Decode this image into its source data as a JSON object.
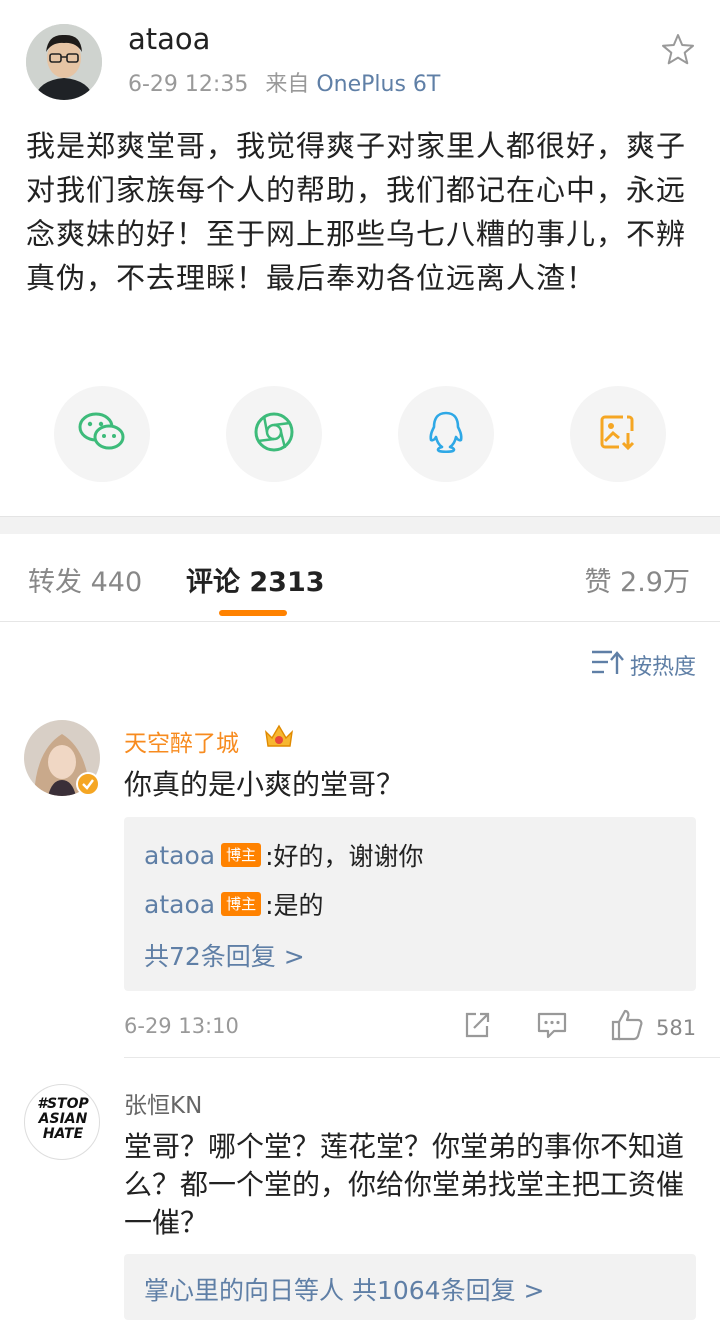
{
  "post": {
    "author": "ataoa",
    "time": "6-29 12:35",
    "from_prefix": "来自",
    "source": "OnePlus 6T",
    "body": "我是郑爽堂哥，我觉得爽子对家里人都很好，爽子对我们家族每个人的帮助，我们都记在心中，永远念爽妹的好！至于网上那些乌七八糟的事儿，不辨真伪，不去理睬！最后奉劝各位远离人渣！"
  },
  "share": [
    "wechat-icon",
    "moments-icon",
    "qq-icon",
    "save-image-icon"
  ],
  "tabs": {
    "repost": "转发 440",
    "comments": "评论 2313",
    "likes": "赞 2.9万"
  },
  "sort_label": "按热度",
  "comments": [
    {
      "user": "天空醉了城",
      "text": "你真的是小爽的堂哥？",
      "replies": [
        {
          "user": "ataoa",
          "badge": "博主",
          "text": ":好的，谢谢你"
        },
        {
          "user": "ataoa",
          "badge": "博主",
          "text": ":是的"
        }
      ],
      "more": "共72条回复 >",
      "time": "6-29 13:10",
      "likes": "581"
    },
    {
      "user": "张恒KN",
      "text": "堂哥？哪个堂？莲花堂？你堂弟的事你不知道么？都一个堂的，你给你堂弟找堂主把工资催一催？",
      "avatar_text": [
        "#STOP",
        "ASIAN",
        "HATE"
      ],
      "more": "掌心里的向日等人  共1064条回复 >"
    }
  ],
  "colors": {
    "accent": "#ff8200",
    "link": "#5f7fa6",
    "vip_name": "#f78b1f"
  }
}
